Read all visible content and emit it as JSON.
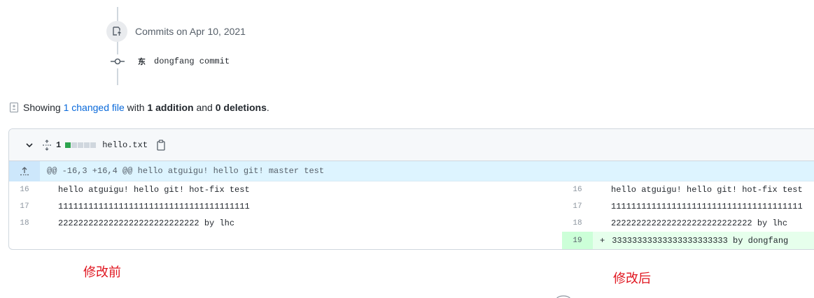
{
  "timeline": {
    "commits_heading": "Commits on Apr 10, 2021",
    "commit": {
      "avatar_char": "东",
      "message": "dongfang commit"
    }
  },
  "summary": {
    "prefix": "Showing ",
    "files_link": "1 changed file",
    "middle": " with ",
    "additions": "1 addition",
    "and": " and ",
    "deletions": "0 deletions",
    "suffix": "."
  },
  "file": {
    "change_count": "1",
    "name": "hello.txt",
    "diffstat_colors": [
      "#2da44e",
      "#d0d7de",
      "#d0d7de",
      "#d0d7de",
      "#d0d7de"
    ],
    "hunk_header": "@@ -16,3 +16,4 @@ hello atguigu! hello git! master test",
    "left_lines": [
      {
        "num": "16",
        "code": "hello atguigu! hello git! hot-fix test"
      },
      {
        "num": "17",
        "code": "11111111111111111111111111111111111111"
      },
      {
        "num": "18",
        "code": "2222222222222222222222222222 by lhc"
      }
    ],
    "right_lines": [
      {
        "num": "16",
        "code": "hello atguigu! hello git! hot-fix test"
      },
      {
        "num": "17",
        "code": "11111111111111111111111111111111111111"
      },
      {
        "num": "18",
        "code": "2222222222222222222222222222 by lhc"
      }
    ],
    "added_line": {
      "num": "19",
      "sign": "+",
      "code": "33333333333333333333333 by dongfang"
    }
  },
  "annotations": {
    "before": "修改前",
    "after": "修改后"
  },
  "colors": {
    "link": "#0969da",
    "added_bg": "#e6ffec",
    "added_num_bg": "#ccffd8",
    "hunk_bg": "#ddf4ff",
    "annotation": "#e0141e"
  }
}
